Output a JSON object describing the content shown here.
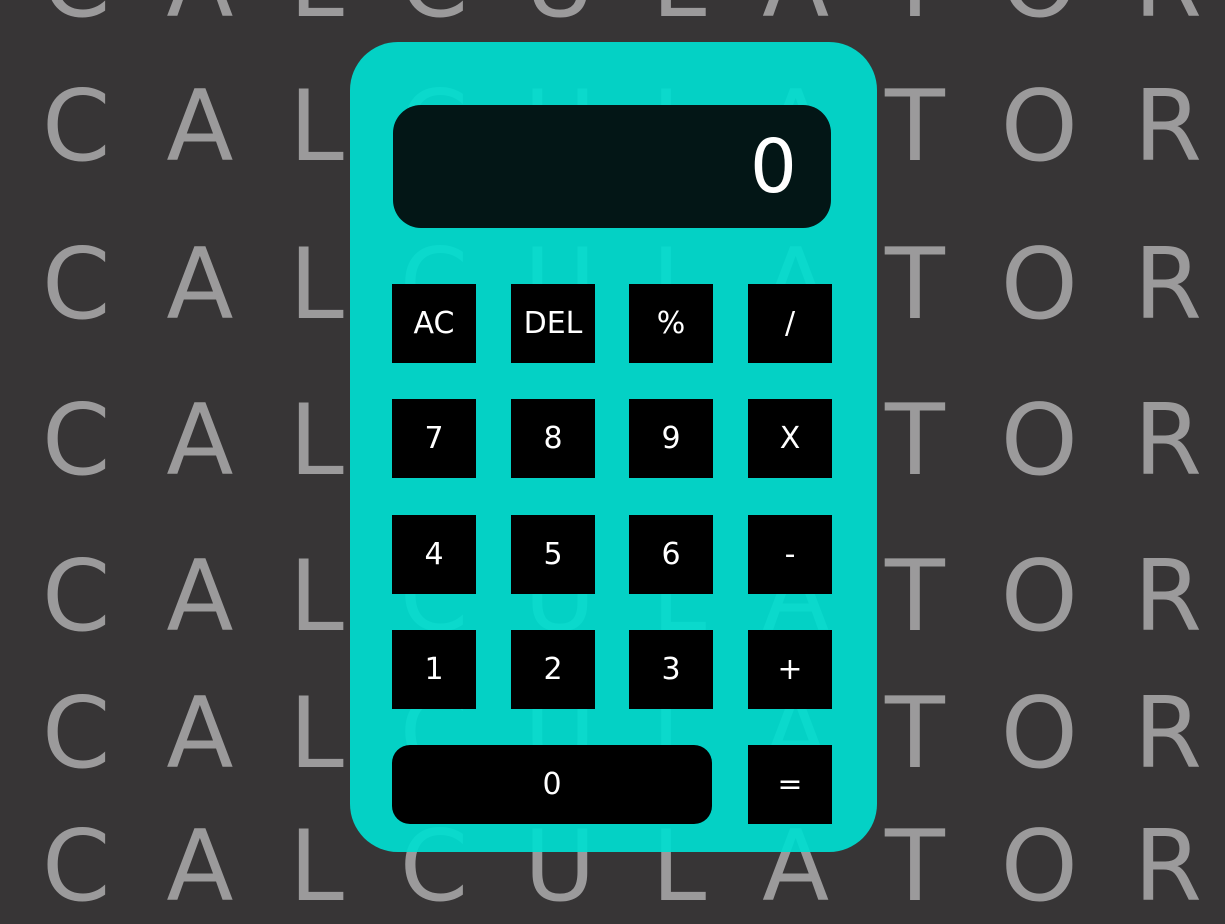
{
  "background": {
    "word_letters": [
      "C",
      "A",
      "L",
      "C",
      "U",
      "L",
      "A",
      "T",
      "O",
      "R"
    ],
    "text_color": "#9b9a9b",
    "page_color": "#373536"
  },
  "calculator": {
    "body_color": "#00ded0",
    "display": {
      "value": "0"
    },
    "keys": [
      {
        "label": "AC",
        "name": "key-all-clear"
      },
      {
        "label": "DEL",
        "name": "key-delete"
      },
      {
        "label": "%",
        "name": "key-percent"
      },
      {
        "label": "/",
        "name": "key-divide"
      },
      {
        "label": "7",
        "name": "key-7"
      },
      {
        "label": "8",
        "name": "key-8"
      },
      {
        "label": "9",
        "name": "key-9"
      },
      {
        "label": "X",
        "name": "key-multiply"
      },
      {
        "label": "4",
        "name": "key-4"
      },
      {
        "label": "5",
        "name": "key-5"
      },
      {
        "label": "6",
        "name": "key-6"
      },
      {
        "label": "-",
        "name": "key-subtract"
      },
      {
        "label": "1",
        "name": "key-1"
      },
      {
        "label": "2",
        "name": "key-2"
      },
      {
        "label": "3",
        "name": "key-3"
      },
      {
        "label": "+",
        "name": "key-add"
      },
      {
        "label": "0",
        "name": "key-0"
      },
      {
        "label": "=",
        "name": "key-equals"
      }
    ]
  }
}
